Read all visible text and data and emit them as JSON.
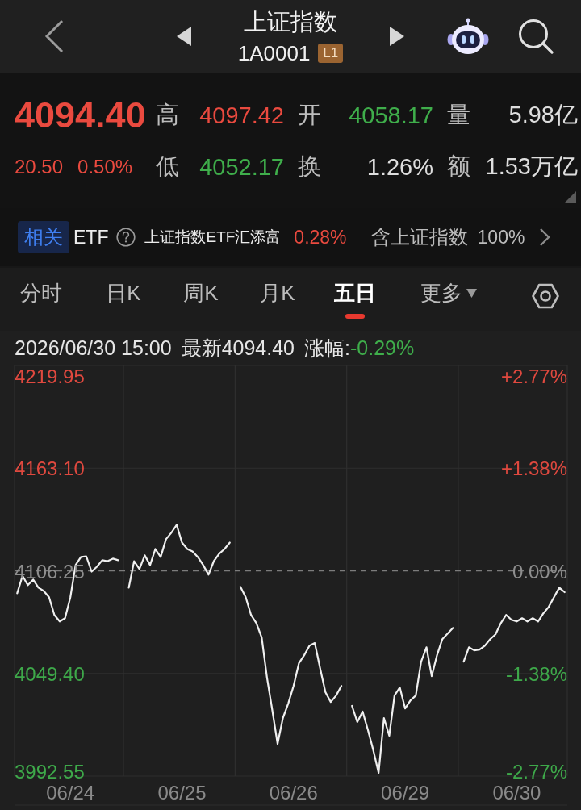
{
  "header": {
    "title": "上证指数",
    "code": "1A0001",
    "level_badge": "L1"
  },
  "quote": {
    "price": {
      "text": "4094.40",
      "color": "#ea4a3f"
    },
    "change": {
      "text": "20.50",
      "color": "#ea4a3f"
    },
    "change_percent": {
      "text": "0.50%",
      "color": "#ea4a3f"
    },
    "stats": [
      {
        "label": "高",
        "value": "4097.42",
        "color": "#ea4a3f"
      },
      {
        "label": "开",
        "value": "4058.17",
        "color": "#3fae4b"
      },
      {
        "label": "量",
        "value": "5.98亿",
        "color": "#dedede"
      },
      {
        "label": "低",
        "value": "4052.17",
        "color": "#3fae4b"
      },
      {
        "label": "换",
        "value": "1.26%",
        "color": "#dedede"
      },
      {
        "label": "额",
        "value": "1.53万亿",
        "color": "#dedede"
      }
    ]
  },
  "related_etf": {
    "badge": "相关",
    "type": "ETF",
    "name": "上证指数ETF汇添富",
    "change": {
      "text": "0.28%",
      "color": "#ea4a3f"
    },
    "holding_label": "含上证指数",
    "holding_share": "100%"
  },
  "tabs": [
    {
      "label": "分时",
      "selected": false,
      "kind": "tab"
    },
    {
      "label": "日K",
      "selected": false,
      "kind": "tab"
    },
    {
      "label": "周K",
      "selected": false,
      "kind": "tab"
    },
    {
      "label": "月K",
      "selected": false,
      "kind": "tab"
    },
    {
      "label": "五日",
      "selected": true,
      "kind": "tab"
    },
    {
      "label": "更多",
      "selected": false,
      "kind": "menu"
    }
  ],
  "chart": {
    "timestamp": "2026/06/30 15:00",
    "latest": "最新4094.40",
    "change_label": "涨幅:",
    "change": {
      "text": "-0.29%",
      "color": "#3fae4b"
    },
    "right_axis": [
      {
        "label": "+2.77%",
        "color": "#e0493f"
      },
      {
        "label": "+1.38%",
        "color": "#e0493f"
      },
      {
        "label": "0.00%",
        "color": "#8e8e8e"
      },
      {
        "label": "-1.38%",
        "color": "#3ea94a"
      },
      {
        "label": "-2.77%",
        "color": "#3ea94a"
      }
    ],
    "chart_data": {
      "type": "line",
      "grid": true,
      "ylim": [
        3992.55,
        4219.95
      ],
      "yticks": [
        {
          "value": 4219.95,
          "label": "4219.95"
        },
        {
          "value": 4163.1,
          "label": "4163.10"
        },
        {
          "value": 4106.25,
          "label": "4106.25"
        },
        {
          "value": 4049.4,
          "label": "4049.40"
        },
        {
          "value": 3992.55,
          "label": "3992.55"
        }
      ],
      "ref_lines": [
        {
          "axis": "y",
          "value": 4106.25
        }
      ],
      "categories": [
        null,
        null,
        null,
        null,
        null,
        null,
        null,
        null,
        null,
        null,
        "06/24",
        null,
        null,
        null,
        null,
        null,
        null,
        null,
        null,
        null,
        null,
        null,
        null,
        null,
        null,
        null,
        null,
        null,
        null,
        null,
        null,
        "06/25",
        null,
        null,
        null,
        null,
        null,
        null,
        null,
        null,
        null,
        null,
        null,
        null,
        null,
        null,
        null,
        null,
        null,
        null,
        null,
        null,
        "06/26",
        null,
        null,
        null,
        null,
        null,
        null,
        null,
        null,
        null,
        null,
        null,
        null,
        null,
        null,
        null,
        null,
        null,
        null,
        null,
        null,
        "06/29",
        null,
        null,
        null,
        null,
        null,
        null,
        null,
        null,
        null,
        null,
        null,
        null,
        null,
        null,
        null,
        null,
        null,
        null,
        null,
        null,
        "06/30",
        null,
        null,
        null,
        null,
        null,
        null,
        null,
        null,
        null
      ],
      "values": [
        4093.8,
        4103.5,
        4098.3,
        4101.4,
        4096.9,
        4095.1,
        4091.6,
        4081.8,
        4078.2,
        4080.0,
        4091.6,
        4109.4,
        4113.9,
        4114.3,
        4105.8,
        4108.5,
        4112.1,
        4111.6,
        4113.0,
        4112.1,
        null,
        4096.9,
        4111.6,
        4107.2,
        4114.8,
        4109.4,
        4118.3,
        4113.9,
        4123.7,
        4127.3,
        4131.7,
        4121.9,
        4118.3,
        4117.0,
        4113.9,
        4109.4,
        4104.1,
        4111.6,
        4115.7,
        4118.3,
        4121.9,
        null,
        4097.4,
        4091.6,
        4081.8,
        4077.3,
        4069.3,
        4047.0,
        4029.2,
        4010.4,
        4024.7,
        4032.7,
        4042.5,
        4055.0,
        4059.5,
        4064.8,
        4066.2,
        4052.3,
        4039.0,
        4033.6,
        4037.2,
        4042.5,
        null,
        4031.4,
        4022.5,
        4028.3,
        4018.0,
        4006.9,
        3994.4,
        4024.7,
        4014.9,
        4037.2,
        4041.6,
        4030.0,
        4034.5,
        4037.2,
        4055.9,
        4063.9,
        4047.9,
        4059.5,
        4068.4,
        4071.5,
        4074.6,
        null,
        4055.9,
        4063.9,
        4062.2,
        4062.6,
        4064.8,
        4068.4,
        4071.1,
        4077.3,
        4081.8,
        4079.1,
        4078.2,
        4080.0,
        4078.2,
        4080.0,
        4078.2,
        4082.7,
        4086.2,
        4091.6,
        4096.9,
        4094.4
      ]
    }
  }
}
